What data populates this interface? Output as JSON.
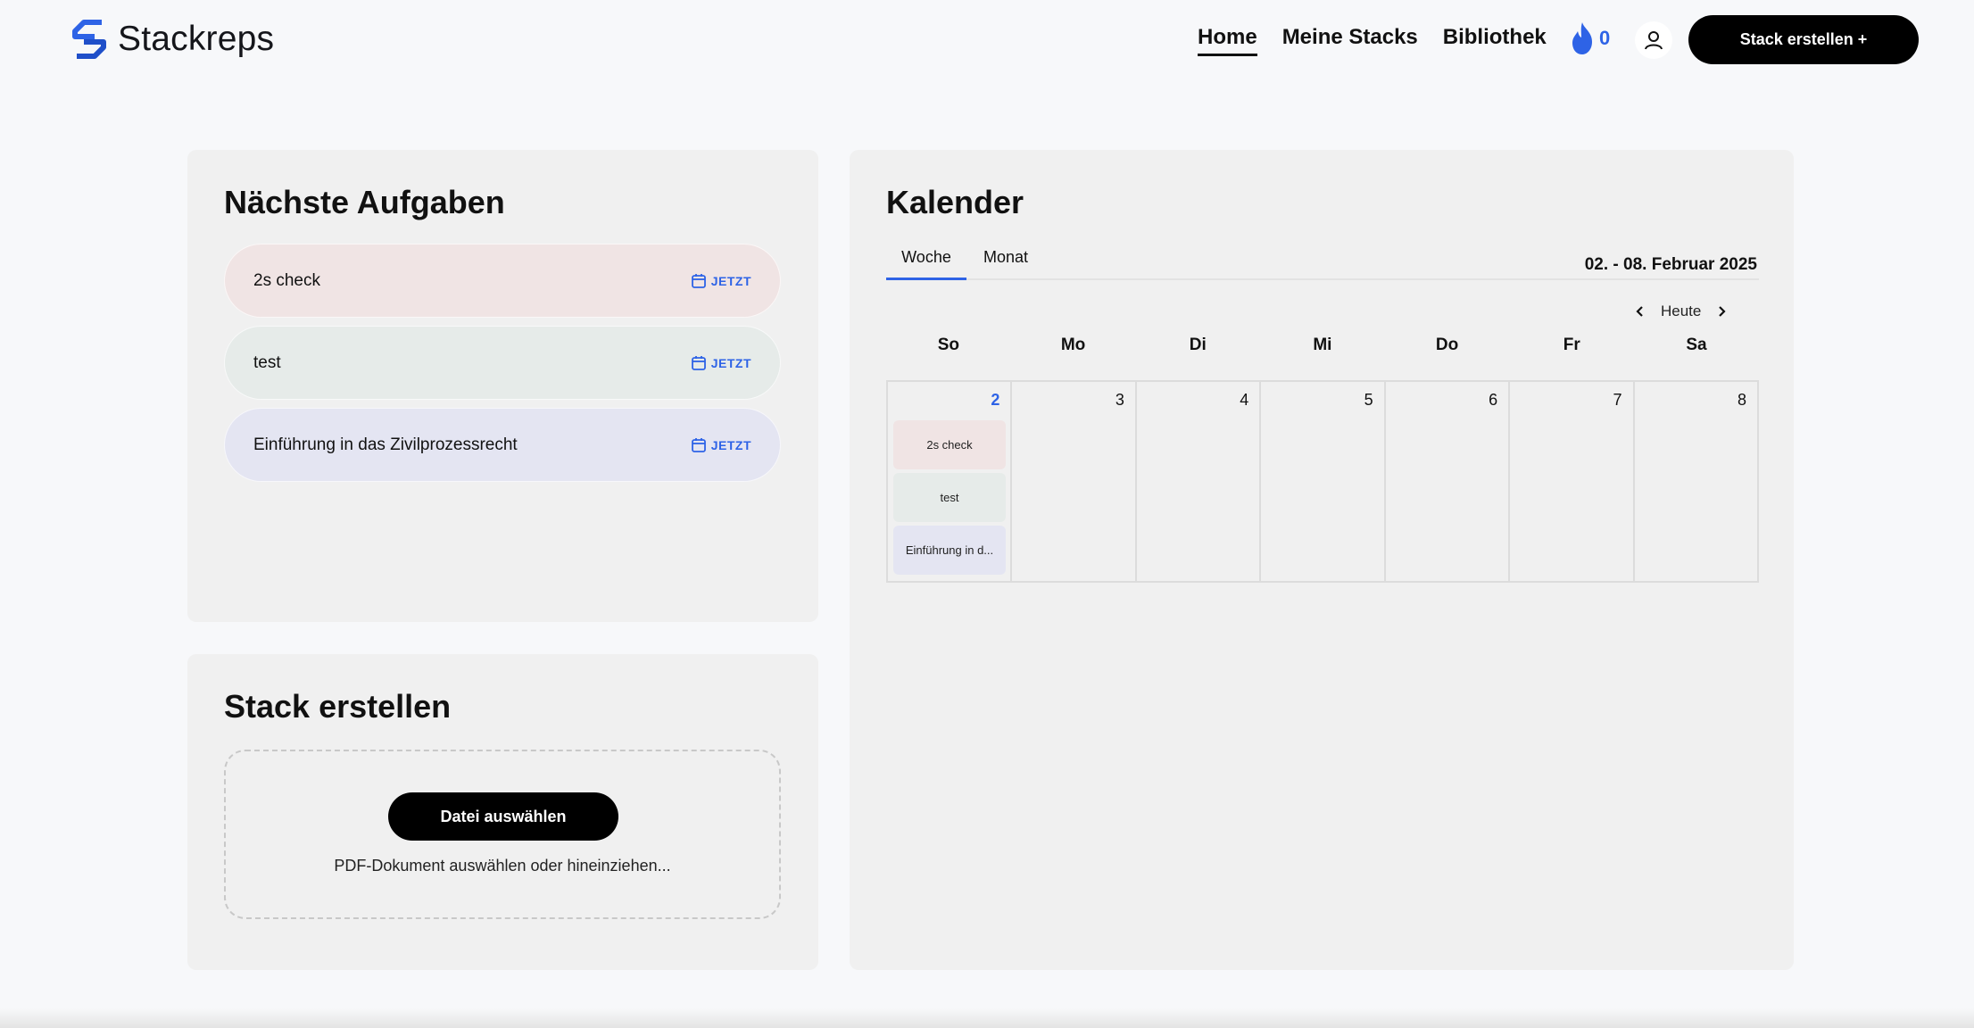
{
  "nav": {
    "brand": "Stackreps",
    "links": [
      "Home",
      "Meine Stacks",
      "Bibliothek"
    ],
    "active_link": "Home",
    "streak_count": "0",
    "create_button": "Stack erstellen +"
  },
  "tasks": {
    "title": "Nächste Aufgaben",
    "items": [
      {
        "name": "2s check",
        "when": "JETZT",
        "color": "#f0e4e4"
      },
      {
        "name": "test",
        "when": "JETZT",
        "color": "#e6ebe9"
      },
      {
        "name": "Einführung in das Zivilprozessrecht",
        "when": "JETZT",
        "color": "#e4e5f2"
      }
    ]
  },
  "create": {
    "title": "Stack erstellen",
    "button": "Datei auswählen",
    "hint": "PDF-Dokument auswählen oder hineinziehen..."
  },
  "calendar": {
    "title": "Kalender",
    "tabs": [
      "Woche",
      "Monat"
    ],
    "active_tab": "Woche",
    "range": "02. - 08. Februar 2025",
    "today_button": "Heute",
    "weekdays": [
      "So",
      "Mo",
      "Di",
      "Mi",
      "Do",
      "Fr",
      "Sa"
    ],
    "days": [
      "2",
      "3",
      "4",
      "5",
      "6",
      "7",
      "8"
    ],
    "today_index": 0,
    "events_day_index": 0,
    "events": [
      {
        "label": "2s check",
        "color": "#f0e4e4"
      },
      {
        "label": "test",
        "color": "#e6ebe9"
      },
      {
        "label": "Einführung in d...",
        "color": "#e4e5f2"
      }
    ]
  },
  "colors": {
    "accent": "#2e63e6",
    "card": "#f0f0f0",
    "background": "#f7f8fa"
  }
}
